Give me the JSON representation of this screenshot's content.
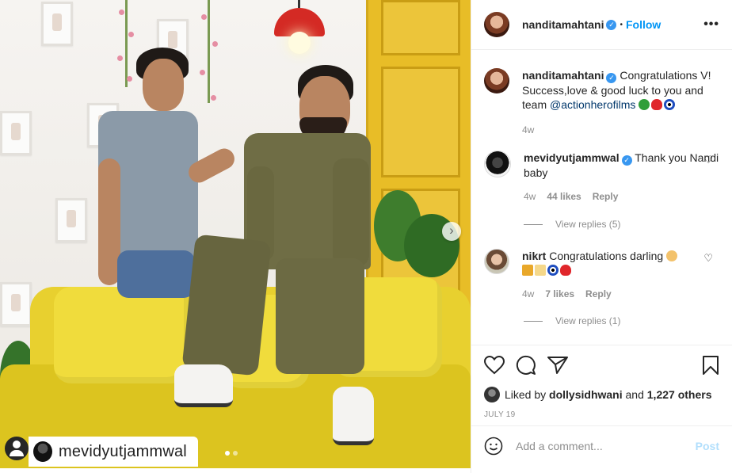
{
  "post": {
    "author": "nanditamahtani",
    "follow_label": "Follow",
    "dot_separator": "•",
    "more_label": "•••",
    "watermark_user": "mevidyutjammwal",
    "image_alt": "Two men posing on a yellow sofa"
  },
  "comments": [
    {
      "user": "nanditamahtani",
      "verified": true,
      "text": "Congratulations V! Success,love & good luck to you and team ",
      "mention": "@actionherofilms",
      "emojis": [
        "shamrock",
        "red-heart",
        "nazar-amulet"
      ],
      "time": "4w"
    },
    {
      "user": "mevidyutjammwal",
      "verified": true,
      "text": "Thank you Nandi baby",
      "time": "4w",
      "likes": "44 likes",
      "reply_label": "Reply",
      "view_replies": "View replies (5)"
    },
    {
      "user": "nikrt",
      "verified": false,
      "text": "Congratulations darling ",
      "emojis": [
        "hugging-person",
        "party-popper",
        "clinking-glasses",
        "nazar-amulet",
        "red-heart"
      ],
      "time": "4w",
      "likes": "7 likes",
      "reply_label": "Reply",
      "view_replies": "View replies (1)"
    }
  ],
  "likes": {
    "prefix": "Liked by ",
    "user": "dollysidhwani",
    "middle": " and ",
    "count": "1,227 others"
  },
  "date": "JULY 19",
  "comment_input": {
    "placeholder": "Add a comment...",
    "post_label": "Post"
  },
  "icons": [
    "heart-icon",
    "comment-icon",
    "share-icon",
    "bookmark-icon",
    "smile-icon",
    "chevron-right-icon",
    "user-tag-icon"
  ],
  "colors": {
    "accent": "#0095f6",
    "verified": "#3897f0",
    "sofa": "#e8d02f",
    "door": "#e8bd27",
    "muted": "#8e8e8e"
  }
}
